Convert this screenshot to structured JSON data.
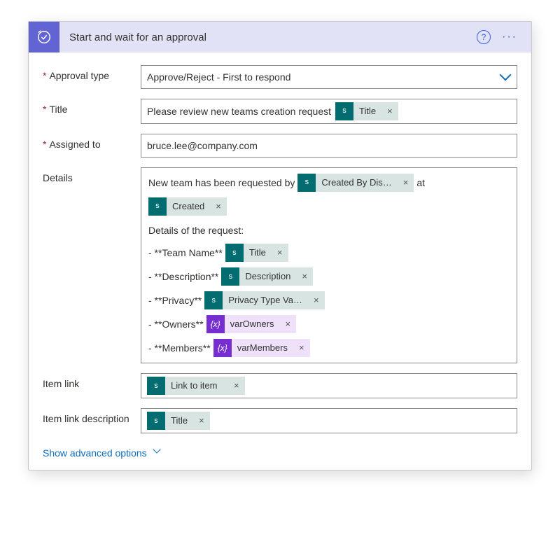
{
  "header": {
    "title": "Start and wait for an approval"
  },
  "fields": {
    "approval_type": {
      "label": "Approval type",
      "value": "Approve/Reject - First to respond"
    },
    "title": {
      "label": "Title",
      "prefix_text": "Please review new teams creation request",
      "token": {
        "type": "sp",
        "label": "Title"
      }
    },
    "assigned_to": {
      "label": "Assigned to",
      "value": "bruce.lee@company.com"
    },
    "details": {
      "label": "Details",
      "intro_before": "New team has been requested by",
      "intro_token1": {
        "type": "sp",
        "label": "Created By Dis…"
      },
      "intro_middle": "at",
      "intro_token2": {
        "type": "sp",
        "label": "Created"
      },
      "subheading": "Details of the request:",
      "items": [
        {
          "bullet": "- **Team Name**",
          "token": {
            "type": "sp",
            "label": "Title"
          }
        },
        {
          "bullet": "- **Description**",
          "token": {
            "type": "sp",
            "label": "Description"
          }
        },
        {
          "bullet": "- **Privacy**",
          "token": {
            "type": "sp",
            "label": "Privacy Type Va…"
          }
        },
        {
          "bullet": "- **Owners**",
          "token": {
            "type": "var",
            "label": "varOwners"
          }
        },
        {
          "bullet": "- **Members**",
          "token": {
            "type": "var",
            "label": "varMembers"
          }
        }
      ]
    },
    "item_link": {
      "label": "Item link",
      "token": {
        "type": "sp",
        "label": "Link to item"
      }
    },
    "item_link_desc": {
      "label": "Item link description",
      "token": {
        "type": "sp",
        "label": "Title"
      }
    }
  },
  "advanced_link": "Show advanced options",
  "icons": {
    "sp_glyph": "s",
    "var_glyph": "{x}",
    "remove_glyph": "×",
    "help_glyph": "?",
    "ellipsis_glyph": "···"
  }
}
